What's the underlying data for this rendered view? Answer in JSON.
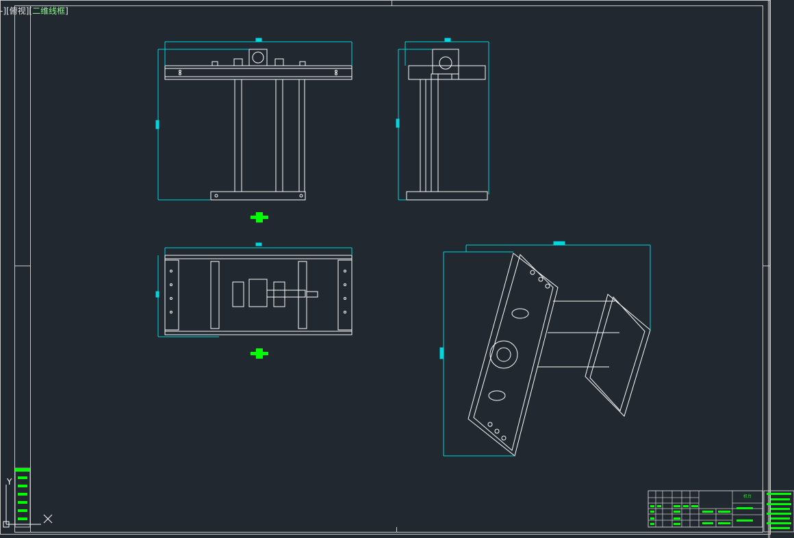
{
  "viewport": {
    "control_label": "-",
    "view_label": "俯视",
    "visual_style_label": "二维线框"
  },
  "ucs": {
    "y_label": "Y",
    "x_label": "X"
  },
  "title_block": {
    "title_text": "机台"
  },
  "colors": {
    "background": "#212830",
    "lines": "#ffffff",
    "frame": "#c8c8c8",
    "dimension": "#00d8e0",
    "highlight": "#00ff00"
  }
}
